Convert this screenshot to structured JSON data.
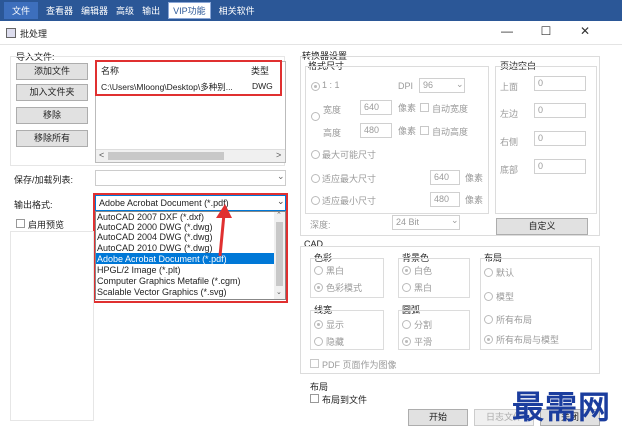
{
  "menubar": {
    "items": [
      "文件",
      "查看器",
      "编辑器",
      "高级",
      "输出",
      "VIP功能",
      "相关软件"
    ]
  },
  "window": {
    "title": "批处理",
    "min": "—",
    "max": "☐",
    "close": "✕"
  },
  "left": {
    "import_label": "导入文件:",
    "buttons": {
      "add_file": "添加文件",
      "add_folder": "加入文件夹",
      "remove": "移除",
      "remove_all": "移除所有"
    },
    "list_headers": {
      "name": "名称",
      "type": "类型"
    },
    "files": [
      {
        "name": "C:\\Users\\Mloong\\Desktop\\多种别...",
        "type": "DWG"
      }
    ],
    "save_label": "保存/加载列表:",
    "output_label": "输出格式:",
    "output_selected": "Adobe Acrobat Document (*.pdf)",
    "output_options": [
      "AutoCAD 2007 DXF (*.dxf)",
      "AutoCAD 2000 DWG (*.dwg)",
      "AutoCAD 2004 DWG (*.dwg)",
      "AutoCAD 2010 DWG (*.dwg)",
      "Adobe Acrobat Document (*.pdf)",
      "HPGL/2 Image (*.plt)",
      "Computer Graphics Metafile (*.cgm)",
      "Scalable Vector Graphics (*.svg)"
    ],
    "preview_label": "启用预览"
  },
  "converter": {
    "title": "转换器设置",
    "format_size": "格式尺寸",
    "ratio": "1 : 1",
    "dpi_label": "DPI",
    "dpi_value": "96",
    "width_label": "宽度",
    "width_value": "640",
    "width_unit": "像素",
    "auto_width": "自动宽度",
    "height_label": "高度",
    "height_value": "480",
    "height_unit": "像素",
    "auto_height": "自动高度",
    "max_size": "最大可能尺寸",
    "fit_max": "适应最大尺寸",
    "fit_max_value": "640",
    "fit_max_unit": "像素",
    "fit_min": "适应最小尺寸",
    "fit_min_value": "480",
    "fit_min_unit": "像素",
    "depth_label": "深度:",
    "depth_value": "24 Bit",
    "margin_title": "页边空白",
    "margins": [
      {
        "label": "上面",
        "value": "0"
      },
      {
        "label": "左边",
        "value": "0"
      },
      {
        "label": "右侧",
        "value": "0"
      },
      {
        "label": "底部",
        "value": "0"
      }
    ],
    "custom_button": "自定义"
  },
  "cad": {
    "title": "CAD",
    "color_title": "色彩",
    "color_opts": [
      "黑白",
      "色彩模式"
    ],
    "bg_title": "背景色",
    "bg_opts": [
      "白色",
      "黑白"
    ],
    "layout_title": "布局",
    "layout_opts": [
      "默认",
      "模型",
      "所有布局",
      "所有布局与模型"
    ],
    "lw_title": "线宽",
    "lw_opts": [
      "显示",
      "隐藏"
    ],
    "arc_title": "圆弧",
    "arc_opts": [
      "分割",
      "平滑"
    ],
    "pdf_as_image": "PDF 页面作为图像"
  },
  "layout_section": {
    "title": "布局",
    "to_file": "布局到文件"
  },
  "footer": {
    "start": "开始",
    "log": "日志文件",
    "close": "关闭"
  },
  "watermark": "最需网",
  "colors": {
    "menubar": "#2b5797",
    "highlight": "#0078d7",
    "annot": "#e03030",
    "watermark": "#1b3d9e"
  }
}
